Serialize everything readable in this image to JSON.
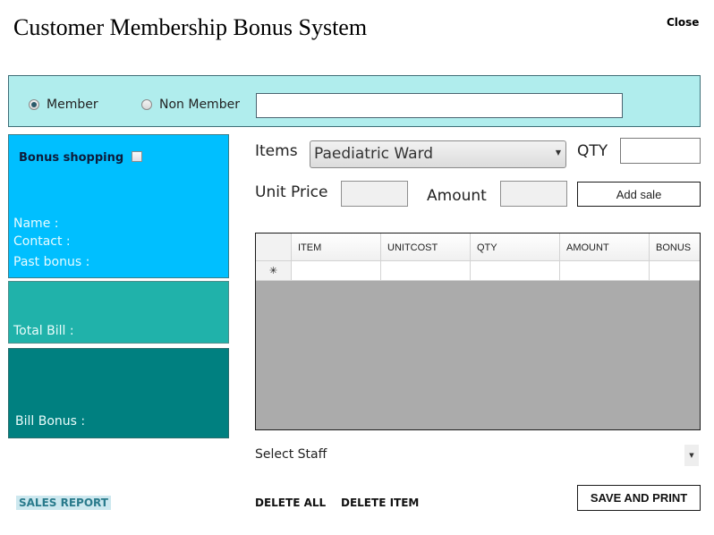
{
  "header": {
    "title": "Customer Membership Bonus System",
    "close_label": "Close"
  },
  "member_bar": {
    "options": [
      {
        "label": "Member",
        "selected": true
      },
      {
        "label": "Non Member",
        "selected": false
      }
    ],
    "search_value": ""
  },
  "info_panel": {
    "bonus_shopping_label": "Bonus shopping",
    "bonus_shopping_checked": false,
    "name_label": "Name :",
    "contact_label": "Contact :",
    "past_bonus_label": "Past bonus :"
  },
  "total_panel": {
    "total_bill_label": "Total Bill :"
  },
  "bonus_panel": {
    "bill_bonus_label": "Bill Bonus :"
  },
  "sale_form": {
    "items_label": "Items",
    "items_selected": "Paediatric Ward",
    "qty_label": "QTY",
    "qty_value": "",
    "unit_price_label": "Unit Price",
    "unit_price_value": "",
    "amount_label": "Amount",
    "amount_value": "",
    "add_sale_label": "Add sale"
  },
  "grid": {
    "columns": [
      "ITEM",
      "UNITCOST",
      "QTY",
      "AMOUNT",
      "BONUS"
    ],
    "new_row_marker": "✳",
    "rows": []
  },
  "staff": {
    "label": "Select Staff"
  },
  "footer": {
    "sales_report_label": "SALES REPORT",
    "delete_all_label": "DELETE ALL",
    "delete_item_label": "DELETE ITEM",
    "save_print_label": "SAVE AND PRINT"
  },
  "colors": {
    "member_bar_bg": "#b0eded",
    "info_panel_bg": "#00bfff",
    "total_panel_bg": "#20b2aa",
    "bonus_panel_bg": "#008080",
    "grid_bg": "#ababab"
  }
}
